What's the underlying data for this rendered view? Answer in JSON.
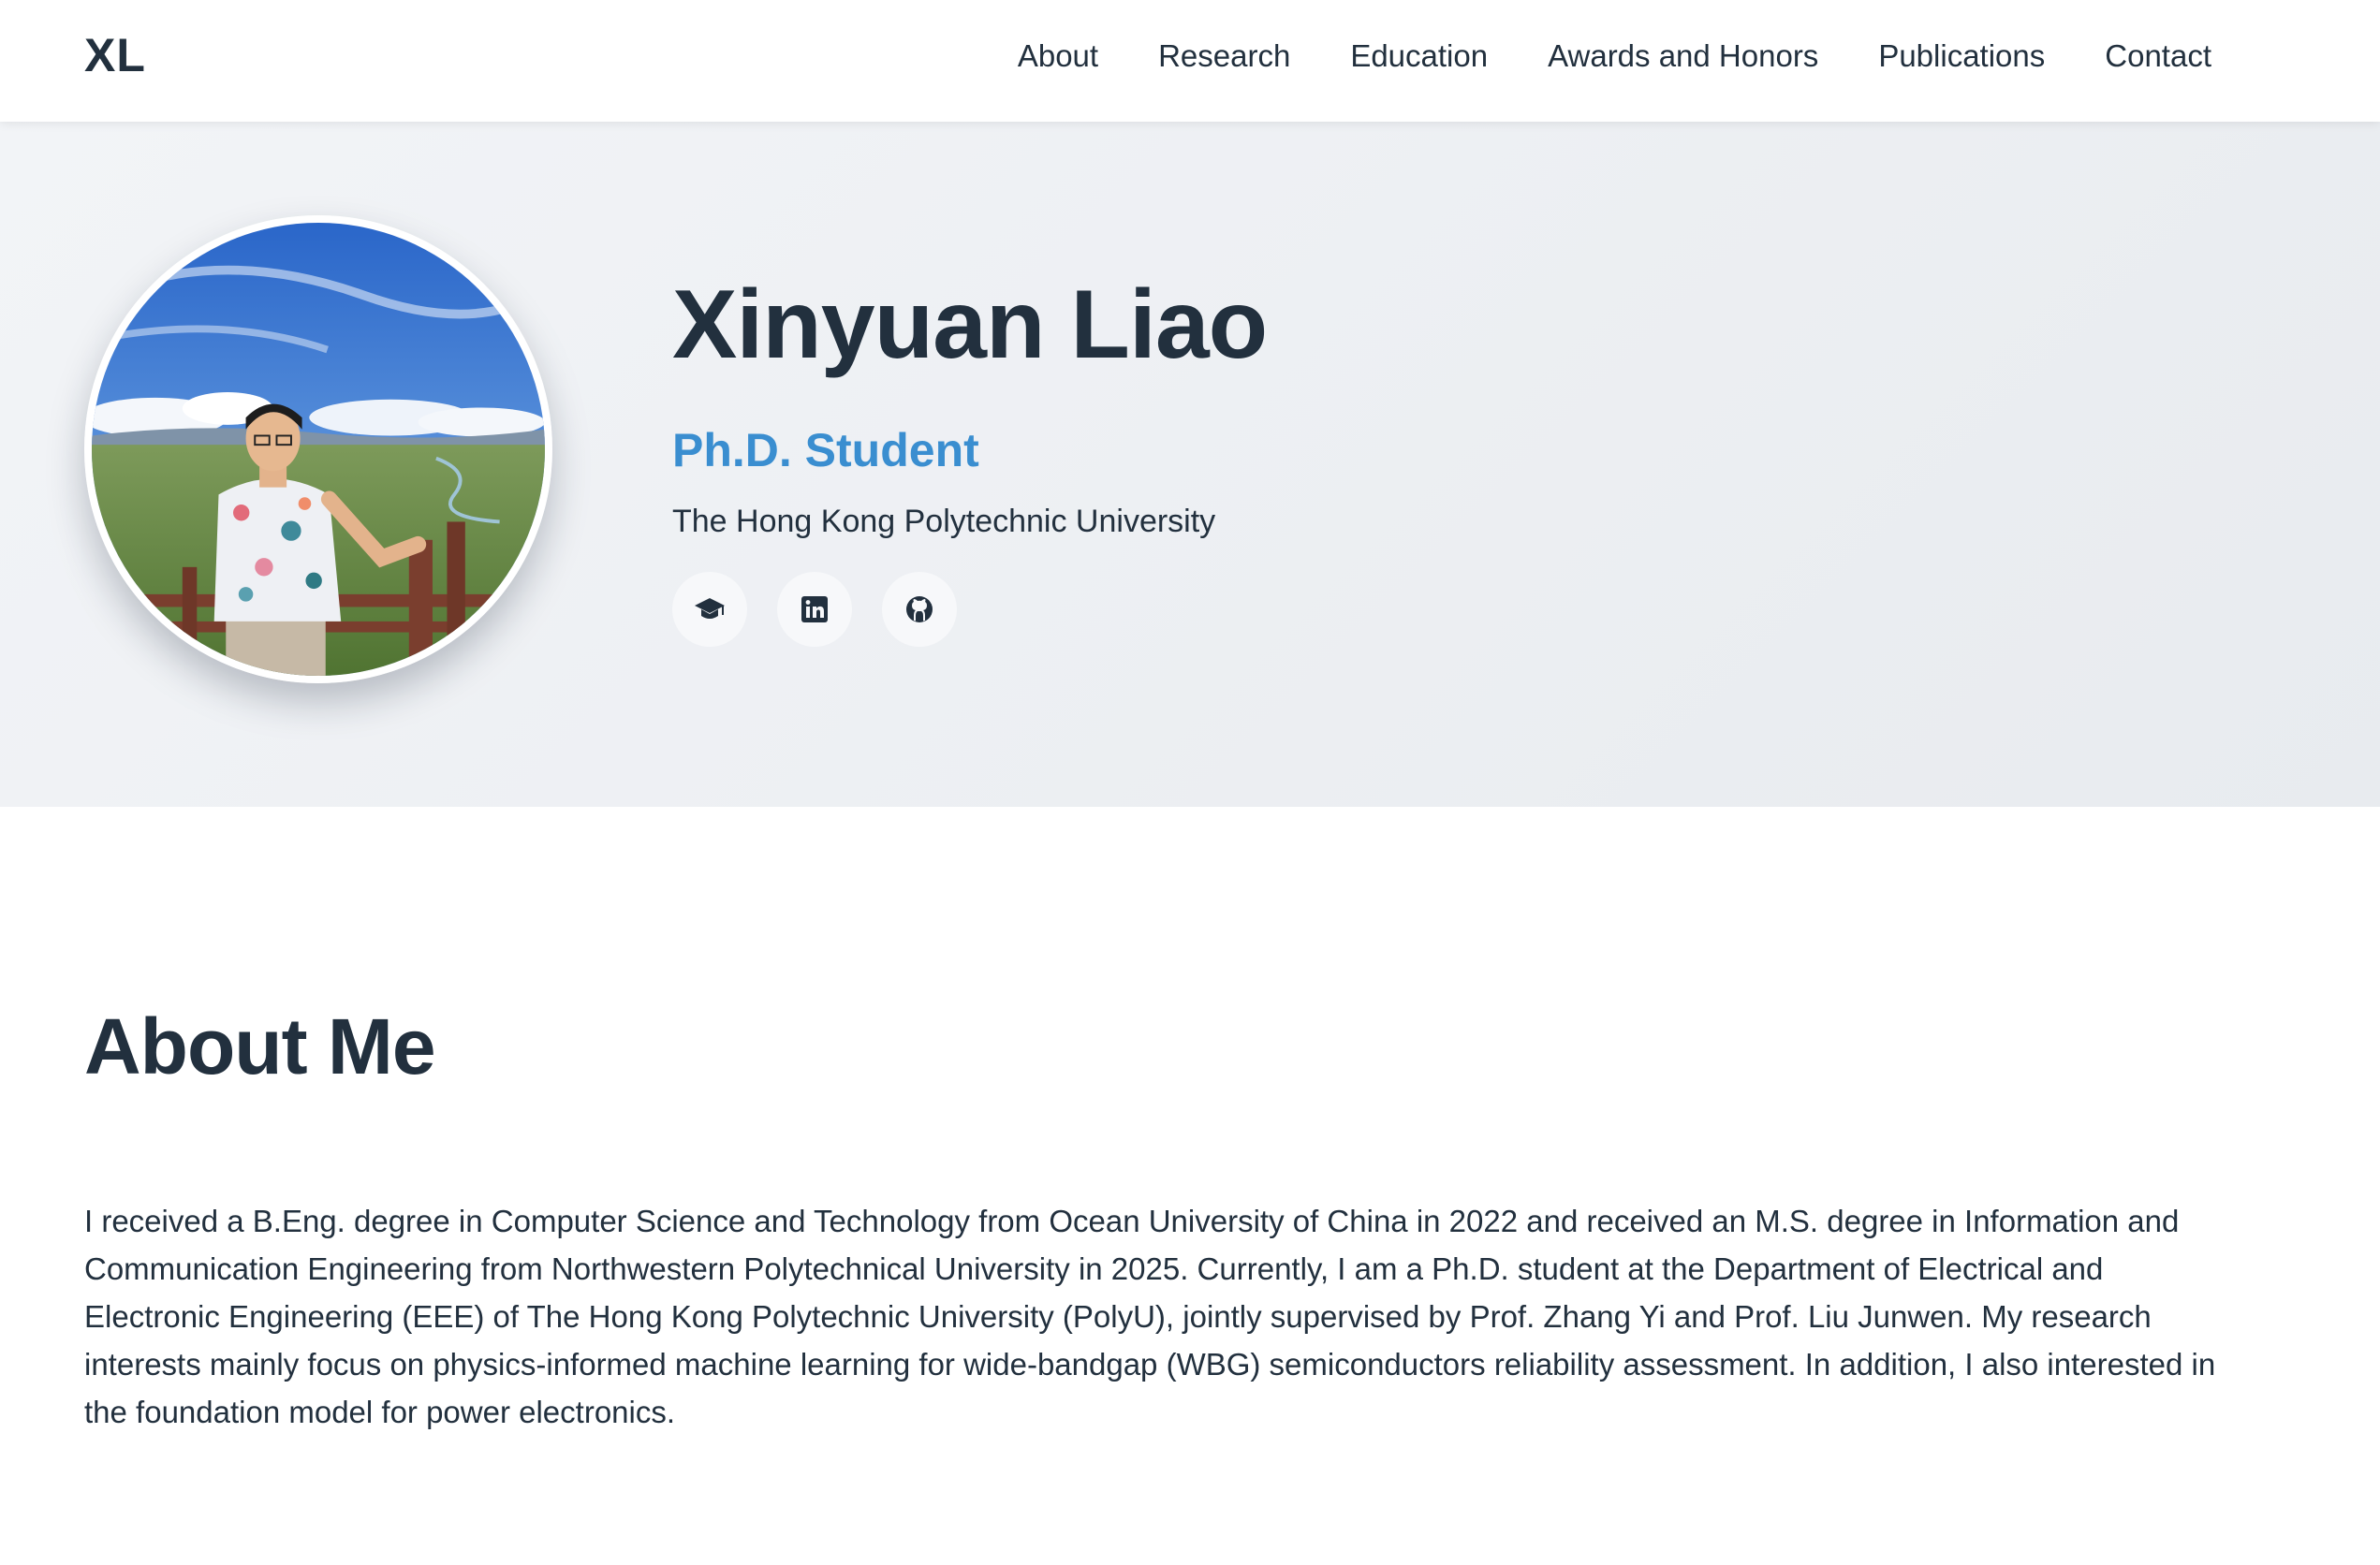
{
  "navbar": {
    "logo": "XL",
    "links": [
      "About",
      "Research",
      "Education",
      "Awards and Honors",
      "Publications",
      "Contact"
    ]
  },
  "hero": {
    "name": "Xinyuan Liao",
    "role": "Ph.D. Student",
    "affiliation": "The Hong Kong Polytechnic University",
    "socials": [
      {
        "icon": "graduation-cap-icon"
      },
      {
        "icon": "linkedin-icon"
      },
      {
        "icon": "github-icon"
      }
    ]
  },
  "about": {
    "title": "About Me",
    "body": "I received a B.Eng. degree in Computer Science and Technology from Ocean University of China in 2022 and received an M.S. degree in Information and Communication Engineering from Northwestern Polytechnical University in 2025. Currently, I am a Ph.D. student at the Department of Electrical and Electronic Engineering (EEE) of The Hong Kong Polytechnic University (PolyU), jointly supervised by Prof. Zhang Yi and Prof. Liu Junwen. My research interests mainly focus on physics-informed machine learning for wide-bandgap (WBG) semiconductors reliability assessment. In addition, I also interested in the foundation model for power electronics."
  },
  "colors": {
    "text": "#22303e",
    "accent": "#3a8ed0",
    "hero_bg": "#eef0f3"
  }
}
